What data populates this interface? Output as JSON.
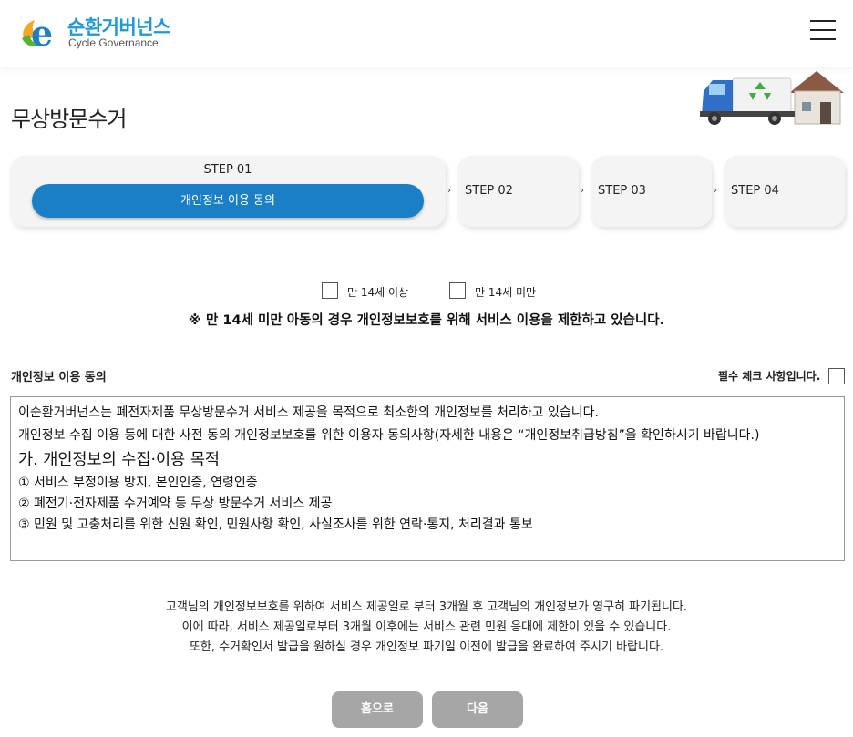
{
  "brand": {
    "name_ko": "순환거버넌스",
    "name_en": "Cycle Governance"
  },
  "page_title": "무상방문수거",
  "steps": [
    {
      "label": "STEP 01",
      "sublabel": "개인정보 이용 동의",
      "active": true
    },
    {
      "label": "STEP 02",
      "active": false
    },
    {
      "label": "STEP 03",
      "active": false
    },
    {
      "label": "STEP 04",
      "active": false
    }
  ],
  "step_arrow": "›",
  "age_options": [
    {
      "label": "만 14세 이상",
      "checked": false
    },
    {
      "label": "만 14세 미만",
      "checked": false
    }
  ],
  "notice": "※ 만 14세 미만 아동의 경우 개인정보보호를 위해 서비스 이용을 제한하고 있습니다.",
  "consent": {
    "title": "개인정보 이용 동의",
    "required_label": "필수 체크 사항입니다.",
    "checked": false,
    "terms": {
      "p1": "이순환거버넌스는 폐전자제품 무상방문수거 서비스 제공을 목적으로 최소한의 개인정보를 처리하고 있습니다.",
      "p2": "개인정보 수집 이용 등에 대한 사전 동의 개인정보보호를 위한 이용자 동의사항(자세한 내용은 “개인정보취급방침”을 확인하시기 바랍니다.)",
      "heading": "가. 개인정보의 수집·이용 목적",
      "items": [
        "① 서비스 부정이용 방지, 본인인증, 연령인증",
        "② 폐전기·전자제품 수거예약 등 무상 방문수거 서비스 제공",
        "③ 민원 및 고충처리를 위한 신원 확인, 민원사항 확인, 사실조사를 위한 연락·통지, 처리결과 통보"
      ]
    }
  },
  "retention_info": [
    "고객님의 개인정보보호를 위하여 서비스 제공일로 부터 3개월 후 고객님의 개인정보가 영구히 파기됩니다.",
    "이에 따라, 서비스 제공일로부터 3개월 이후에는 서비스 관련 민원 응대에 제한이 있을 수 있습니다.",
    "또한, 수거확인서 발급을 원하실 경우 개인정보 파기일 이전에 발급을 완료하여 주시기 바랍니다."
  ],
  "buttons": {
    "home": "홈으로",
    "next": "다음"
  },
  "icons": {
    "logo": "e-leaf-logo",
    "menu": "hamburger-menu-icon",
    "hero": "recycling-truck-house-illustration"
  },
  "colors": {
    "brand_blue": "#1d9ad6",
    "active_step": "#1b7fc5",
    "button_gray": "#a6a6a6"
  }
}
